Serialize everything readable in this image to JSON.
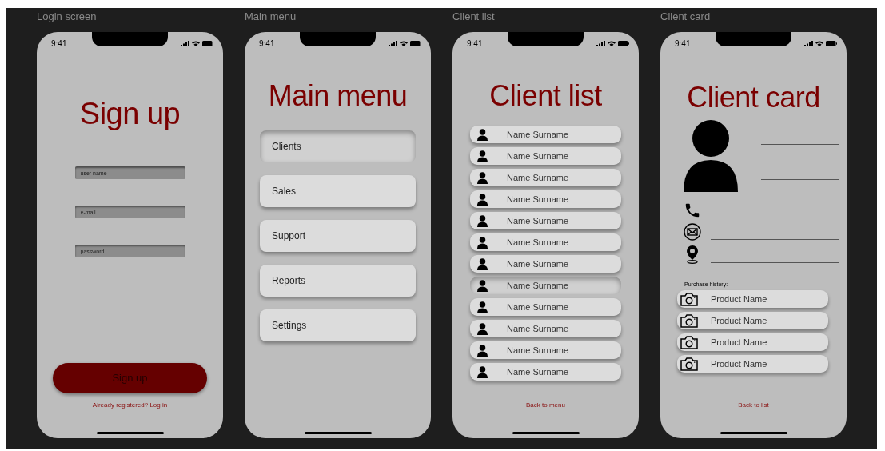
{
  "screens": [
    {
      "kind": "login",
      "label": "Login screen",
      "time": "9:41",
      "title": "Sign up",
      "fields": [
        {
          "placeholder": "user name"
        },
        {
          "placeholder": "e-mail"
        },
        {
          "placeholder": "password"
        }
      ],
      "button": "Sign up",
      "link": "Already registered? Log in"
    },
    {
      "kind": "menu",
      "label": "Main menu",
      "time": "9:41",
      "title": "Main menu",
      "items": [
        {
          "label": "Clients",
          "selected": true
        },
        {
          "label": "Sales",
          "selected": false
        },
        {
          "label": "Support",
          "selected": false
        },
        {
          "label": "Reports",
          "selected": false
        },
        {
          "label": "Settings",
          "selected": false
        }
      ]
    },
    {
      "kind": "list",
      "label": "Client list",
      "time": "9:41",
      "title": "Client list",
      "items": [
        {
          "name": "Name Surname",
          "selected": false
        },
        {
          "name": "Name Surname",
          "selected": false
        },
        {
          "name": "Name Surname",
          "selected": false
        },
        {
          "name": "Name Surname",
          "selected": false
        },
        {
          "name": "Name Surname",
          "selected": false
        },
        {
          "name": "Name Surname",
          "selected": false
        },
        {
          "name": "Name Surname",
          "selected": false
        },
        {
          "name": "Name Surname",
          "selected": true
        },
        {
          "name": "Name Surname",
          "selected": false
        },
        {
          "name": "Name Surname",
          "selected": false
        },
        {
          "name": "Name Surname",
          "selected": false
        },
        {
          "name": "Name Surname",
          "selected": false
        }
      ],
      "link": "Back to menu"
    },
    {
      "kind": "card",
      "label": "Client card",
      "time": "9:41",
      "title": "Client card",
      "history_label": "Purchase history:",
      "products": [
        {
          "name": "Product Name"
        },
        {
          "name": "Product Name"
        },
        {
          "name": "Product Name"
        },
        {
          "name": "Product Name"
        }
      ],
      "link": "Back to list"
    }
  ]
}
